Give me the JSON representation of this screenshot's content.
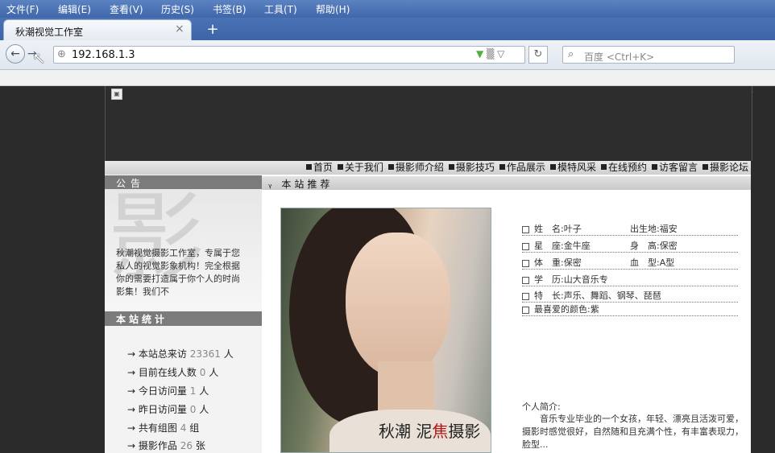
{
  "browser": {
    "menu": [
      "文件(F)",
      "编辑(E)",
      "查看(V)",
      "历史(S)",
      "书签(B)",
      "工具(T)",
      "帮助(H)"
    ],
    "tab_title": "秋潮视觉工作室",
    "tab_close": "×",
    "new_tab": "+",
    "url": "192.168.1.3",
    "search_placeholder": "百度 <Ctrl+K>"
  },
  "site": {
    "nav": [
      "首页",
      "关于我们",
      "摄影师介绍",
      "摄影技巧",
      "作品展示",
      "模特风采",
      "在线预约",
      "访客留言",
      "摄影论坛"
    ],
    "notice_title": "公告",
    "notice_bg_char": "影",
    "notice_text": "秋潮视觉摄影工作室，专属于您私人的视觉影象机构！完全根据你的需要打造属于你个人的时尚影集！我们不",
    "stats_title": "本站统计",
    "stats": [
      {
        "label": "本站总来访",
        "value": "23361",
        "unit": "人"
      },
      {
        "label": "目前在线人数",
        "value": "0",
        "unit": "人"
      },
      {
        "label": "今日访问量",
        "value": "1",
        "unit": "人"
      },
      {
        "label": "昨日访问量",
        "value": "0",
        "unit": "人"
      },
      {
        "label": "共有组图",
        "value": "4",
        "unit": "组"
      },
      {
        "label": "摄影作品",
        "value": "26",
        "unit": "张"
      }
    ],
    "rec_title": "本站推荐",
    "photo_signature_a": "秋潮 泥",
    "photo_signature_b": "焦",
    "photo_signature_c": "摄影",
    "profile": [
      {
        "a": "姓　名:叶子",
        "b": "出生地:福安"
      },
      {
        "a": "星　座:金牛座",
        "b": "身　高:保密"
      },
      {
        "a": "体　重:保密",
        "b": "血　型:A型"
      },
      {
        "a": "学　历:山大音乐专",
        "b": ""
      },
      {
        "a": "特　长:声乐、舞蹈、钢琴、琵琶",
        "b": ""
      },
      {
        "a": "最喜爱的颜色:紫",
        "b": ""
      }
    ],
    "bio_label": "个人简介:",
    "bio_text": "音乐专业毕业的一个女孩，年轻、漂亮且活泼可爱，摄影时感觉很好，自然随和且充满个性，有丰富表现力，脸型..."
  }
}
